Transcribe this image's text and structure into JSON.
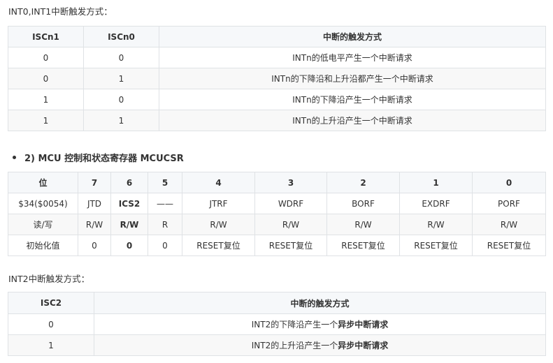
{
  "section1": {
    "title": "INT0,INT1中断触发方式：",
    "headers": [
      "ISCn1",
      "ISCn0",
      "中断的触发方式"
    ],
    "rows": [
      [
        "0",
        "0",
        "INTn的低电平产生一个中断请求"
      ],
      [
        "0",
        "1",
        "INTn的下降沿和上升沿都产生一个中断请求"
      ],
      [
        "1",
        "0",
        "INTn的下降沿产生一个中断请求"
      ],
      [
        "1",
        "1",
        "INTn的上升沿产生一个中断请求"
      ]
    ]
  },
  "section2": {
    "title": "2) MCU 控制和状态寄存器 MCUCSR",
    "headers": [
      "位",
      "7",
      "6",
      "5",
      "4",
      "3",
      "2",
      "1",
      "0"
    ],
    "rows": [
      [
        "$34($0054)",
        "JTD",
        "ICS2",
        "——",
        "JTRF",
        "WDRF",
        "BORF",
        "EXDRF",
        "PORF"
      ],
      [
        "读/写",
        "R/W",
        "R/W",
        "R",
        "R/W",
        "R/W",
        "R/W",
        "R/W",
        "R/W"
      ],
      [
        "初始化值",
        "0",
        "0",
        "0",
        "RESET复位",
        "RESET复位",
        "RESET复位",
        "RESET复位",
        "RESET复位"
      ]
    ]
  },
  "section3": {
    "title": "INT2中断触发方式：",
    "headers": [
      "ISC2",
      "中断的触发方式"
    ],
    "rows": [
      {
        "c0": "0",
        "prefix": "INT2的下降沿产生一个",
        "bold": "异步中断请求"
      },
      {
        "c0": "1",
        "prefix": "INT2的上升沿产生一个",
        "bold": "异步中断请求"
      }
    ]
  }
}
